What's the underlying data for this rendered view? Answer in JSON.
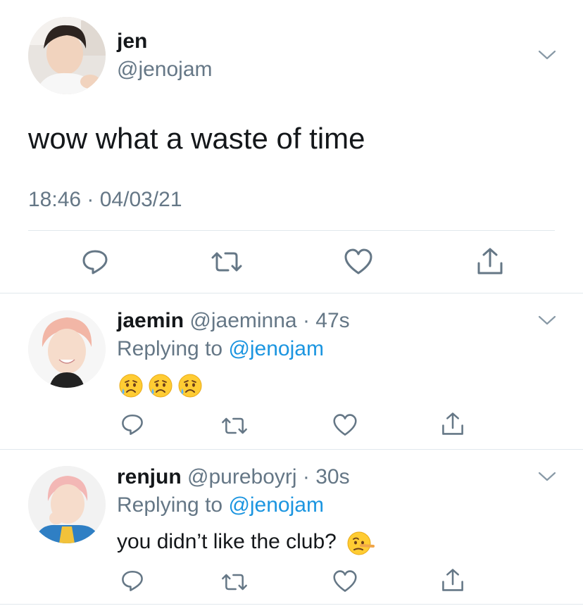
{
  "main_tweet": {
    "display_name": "jen",
    "handle": "@jenojam",
    "text": "wow what a waste of time",
    "timestamp": "18:46 · 04/03/21"
  },
  "replies": [
    {
      "display_name": "jaemin",
      "handle": "@jaeminna",
      "age": "· 47s",
      "replying_prefix": "Replying to",
      "replying_to": "@jenojam",
      "emojis": [
        "sad-sweat-emoji",
        "sad-sweat-emoji",
        "sad-sweat-emoji"
      ]
    },
    {
      "display_name": "renjun",
      "handle": "@pureboyrj",
      "age": "· 30s",
      "replying_prefix": "Replying to",
      "replying_to": "@jenojam",
      "text": "you didn’t like the club?",
      "emoji": "lying-face-emoji"
    }
  ],
  "icons": {
    "reply": "reply-icon",
    "retweet": "retweet-icon",
    "like": "like-icon",
    "share": "share-icon",
    "more": "chevron-down-icon"
  },
  "colors": {
    "text": "#14171a",
    "muted": "#657786",
    "link": "#1b95e0",
    "divider": "#e1e8ed",
    "icon": "#657786"
  }
}
